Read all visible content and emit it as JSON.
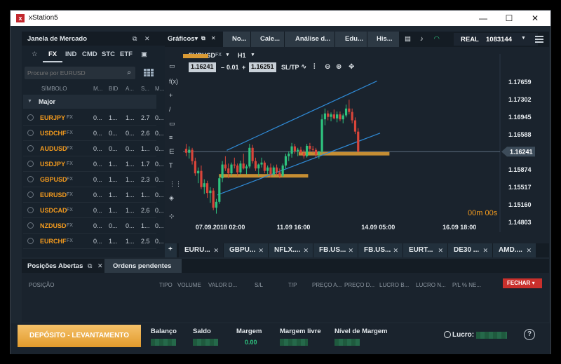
{
  "window": {
    "title": "xStation5",
    "logo_letter": "x",
    "minimize": "—",
    "maximize": "☐",
    "close": "✕"
  },
  "market": {
    "title": "Janela de Mercado",
    "search_placeholder": "Procure por EURUSD",
    "tabs": [
      "☆",
      "FX",
      "IND",
      "CMD",
      "STC",
      "ETF"
    ],
    "active_tab": "FX",
    "columns": [
      "SÍMBOLO",
      "M...",
      "BID",
      "A...",
      "S...",
      "M..."
    ],
    "group": "Major",
    "rows": [
      {
        "symbol": "EURJPY",
        "type": "FX",
        "c1": "0...",
        "c2": "1...",
        "c3": "1...",
        "c4": "2.7",
        "c5": "0..."
      },
      {
        "symbol": "USDCHF",
        "type": "FX",
        "c1": "0...",
        "c2": "0...",
        "c3": "0...",
        "c4": "2.6",
        "c5": "0..."
      },
      {
        "symbol": "AUDUSD",
        "type": "FX",
        "c1": "0...",
        "c2": "0...",
        "c3": "0...",
        "c4": "1...",
        "c5": "0..."
      },
      {
        "symbol": "USDJPY",
        "type": "FX",
        "c1": "0...",
        "c2": "1...",
        "c3": "1...",
        "c4": "1.7",
        "c5": "0..."
      },
      {
        "symbol": "GBPUSD",
        "type": "FX",
        "c1": "0...",
        "c2": "1...",
        "c3": "1...",
        "c4": "2.3",
        "c5": "0..."
      },
      {
        "symbol": "EURUSD",
        "type": "FX",
        "c1": "0...",
        "c2": "1...",
        "c3": "1...",
        "c4": "1...",
        "c5": "0..."
      },
      {
        "symbol": "USDCAD",
        "type": "FX",
        "c1": "0...",
        "c2": "1...",
        "c3": "1...",
        "c4": "2.6",
        "c5": "0..."
      },
      {
        "symbol": "NZDUSD",
        "type": "FX",
        "c1": "0...",
        "c2": "0...",
        "c3": "0...",
        "c4": "1...",
        "c5": "0..."
      },
      {
        "symbol": "EURCHF",
        "type": "FX",
        "c1": "0...",
        "c2": "1...",
        "c3": "1...",
        "c4": "2.5",
        "c5": "0..."
      }
    ]
  },
  "chart_tabs": {
    "graficos": "Gráficos▾",
    "tabs": [
      "No...",
      "Cale...",
      "Análise d...",
      "Edu...",
      "His..."
    ],
    "account_mode": "REAL",
    "account_number": "1083144"
  },
  "chart_toolbar": {
    "symbol": "EURUSD",
    "type": "FX",
    "timeframe": "H1",
    "bid": "1.16241",
    "spread": "0.01",
    "ask": "1.16251",
    "sltp": "SL/TP",
    "minus": "–",
    "plus": "+"
  },
  "chart_data": {
    "type": "candlestick",
    "symbol": "EURUSD",
    "timeframe": "H1",
    "y_ticks": [
      "1.17659",
      "1.17302",
      "1.16945",
      "1.16588",
      "1.16241",
      "1.15874",
      "1.15517",
      "1.15160",
      "1.14803"
    ],
    "ylim": [
      1.14803,
      1.17659
    ],
    "x_ticks": [
      "07.09.2018 02:00",
      "11.09 16:00",
      "14.09 05:00",
      "16.09 18:00"
    ],
    "current_price": "1.16241",
    "countdown": "00m 00s",
    "candles": [
      [
        1.163,
        1.164,
        1.1615,
        1.1622
      ],
      [
        1.1622,
        1.1635,
        1.161,
        1.1628
      ],
      [
        1.1628,
        1.1632,
        1.1598,
        1.1605
      ],
      [
        1.1605,
        1.1612,
        1.1575,
        1.158
      ],
      [
        1.158,
        1.1592,
        1.156,
        1.1585
      ],
      [
        1.1585,
        1.1596,
        1.1548,
        1.1552
      ],
      [
        1.1552,
        1.1568,
        1.1538,
        1.156
      ],
      [
        1.156,
        1.1565,
        1.153,
        1.154
      ],
      [
        1.154,
        1.1552,
        1.152,
        1.1545
      ],
      [
        1.1545,
        1.155,
        1.1505,
        1.151
      ],
      [
        1.151,
        1.1528,
        1.1498,
        1.1522
      ],
      [
        1.1522,
        1.1575,
        1.1518,
        1.157
      ],
      [
        1.157,
        1.1605,
        1.1562,
        1.1598
      ],
      [
        1.1598,
        1.1615,
        1.1585,
        1.159
      ],
      [
        1.159,
        1.16,
        1.157,
        1.158
      ],
      [
        1.158,
        1.1602,
        1.1575,
        1.1598
      ],
      [
        1.1598,
        1.1612,
        1.159,
        1.1596
      ],
      [
        1.1596,
        1.16,
        1.1575,
        1.1582
      ],
      [
        1.1582,
        1.1606,
        1.1578,
        1.16
      ],
      [
        1.16,
        1.162,
        1.1588,
        1.159
      ],
      [
        1.159,
        1.1598,
        1.1578,
        1.1594
      ],
      [
        1.1594,
        1.164,
        1.159,
        1.1632
      ],
      [
        1.1632,
        1.1638,
        1.16,
        1.1605
      ],
      [
        1.1605,
        1.1612,
        1.1585,
        1.159
      ],
      [
        1.159,
        1.16,
        1.1575,
        1.1598
      ],
      [
        1.1598,
        1.1612,
        1.1592,
        1.1602
      ],
      [
        1.1602,
        1.1606,
        1.158,
        1.1585
      ],
      [
        1.1585,
        1.1596,
        1.1578,
        1.1592
      ],
      [
        1.1592,
        1.16,
        1.1572,
        1.1578
      ],
      [
        1.1578,
        1.1596,
        1.1574,
        1.1592
      ],
      [
        1.1592,
        1.1598,
        1.1576,
        1.1582
      ],
      [
        1.1582,
        1.159,
        1.157,
        1.1575
      ],
      [
        1.1575,
        1.16,
        1.1572,
        1.1596
      ],
      [
        1.1596,
        1.162,
        1.159,
        1.1615
      ],
      [
        1.1615,
        1.1625,
        1.1605,
        1.162
      ],
      [
        1.162,
        1.1642,
        1.1612,
        1.1635
      ],
      [
        1.1635,
        1.164,
        1.162,
        1.1625
      ],
      [
        1.1625,
        1.1632,
        1.1615,
        1.1628
      ],
      [
        1.1628,
        1.1634,
        1.1618,
        1.1622
      ],
      [
        1.1622,
        1.1628,
        1.161,
        1.1615
      ],
      [
        1.1615,
        1.164,
        1.1612,
        1.1636
      ],
      [
        1.1636,
        1.1642,
        1.1624,
        1.163
      ],
      [
        1.163,
        1.1636,
        1.1622,
        1.1628
      ],
      [
        1.1628,
        1.1632,
        1.1612,
        1.1618
      ],
      [
        1.1618,
        1.1626,
        1.161,
        1.1624
      ],
      [
        1.1624,
        1.17,
        1.162,
        1.169
      ],
      [
        1.169,
        1.1712,
        1.1678,
        1.1702
      ],
      [
        1.1702,
        1.1708,
        1.1688,
        1.1695
      ],
      [
        1.1695,
        1.1704,
        1.1686,
        1.17
      ],
      [
        1.17,
        1.171,
        1.169,
        1.1692
      ],
      [
        1.1692,
        1.1706,
        1.1684,
        1.17
      ],
      [
        1.17,
        1.1706,
        1.1686,
        1.169
      ],
      [
        1.169,
        1.1702,
        1.1682,
        1.1698
      ],
      [
        1.1698,
        1.172,
        1.1694,
        1.1712
      ],
      [
        1.1712,
        1.173,
        1.17,
        1.1705
      ],
      [
        1.1705,
        1.1712,
        1.1682,
        1.1688
      ],
      [
        1.1688,
        1.1694,
        1.166,
        1.1665
      ],
      [
        1.1665,
        1.1672,
        1.163,
        1.1624
      ]
    ],
    "channel_upper": [
      [
        0.14,
        1.1627
      ],
      [
        0.62,
        1.1768
      ]
    ],
    "channel_lower": [
      [
        0.11,
        1.1536
      ],
      [
        0.63,
        1.1662
      ]
    ],
    "support_lines": [
      [
        0.115,
        0.4,
        1.1575
      ],
      [
        0.37,
        0.66,
        1.162
      ]
    ],
    "price_tag_top": "1.16241"
  },
  "bottom_tabs": [
    "EURU...",
    "GBPU...",
    "NFLX....",
    "FB.US...",
    "FB.US...",
    "EURT...",
    "DE30 ...",
    "AMD...."
  ],
  "positions": {
    "tab_open": "Posições Abertas",
    "tab_pending": "Ordens pendentes",
    "columns": [
      "POSIÇÃO",
      "TIPO",
      "VOLUME",
      "VALOR D...",
      "S/L",
      "T/P",
      "PREÇO A...",
      "PREÇO D...",
      "LUCRO B...",
      "LUCRO N...",
      "P/L % NE..."
    ],
    "close_button": "FECHAR"
  },
  "footer": {
    "deposit_button": "DEPÓSITO - LEVANTAMENTO",
    "labels": [
      "Balanço",
      "Saldo",
      "Margem",
      "Margem livre",
      "Nível de Margem"
    ],
    "margin_value": "0.00",
    "profit_label": "Lucro:",
    "help": "?"
  },
  "colors": {
    "accent": "#f29a1e",
    "bull": "#2ec27e",
    "bear": "#d9453a",
    "channel": "#2f8ad6",
    "support": "#d99a34"
  }
}
